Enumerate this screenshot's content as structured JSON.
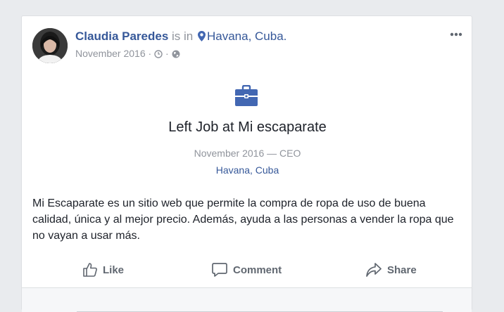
{
  "post": {
    "author": "Claudia Paredes",
    "is_in": "is in",
    "location": "Havana, Cuba.",
    "date": "November 2016",
    "separator": "·"
  },
  "event": {
    "icon": "briefcase-icon",
    "title": "Left Job at Mi escaparate",
    "subtitle": "November 2016 — CEO",
    "place": "Havana, Cuba"
  },
  "body": {
    "text": "Mi Escaparate es un sitio web que permite la compra de ropa de uso de buena calidad, única y al mejor precio. Además, ayuda a las personas a vender la ropa que no vayan a usar más."
  },
  "actions": {
    "like": "Like",
    "comment": "Comment",
    "share": "Share"
  },
  "colors": {
    "link": "#365899",
    "muted": "#90949c",
    "text": "#1d2129",
    "accent_icon": "#4267b2"
  }
}
